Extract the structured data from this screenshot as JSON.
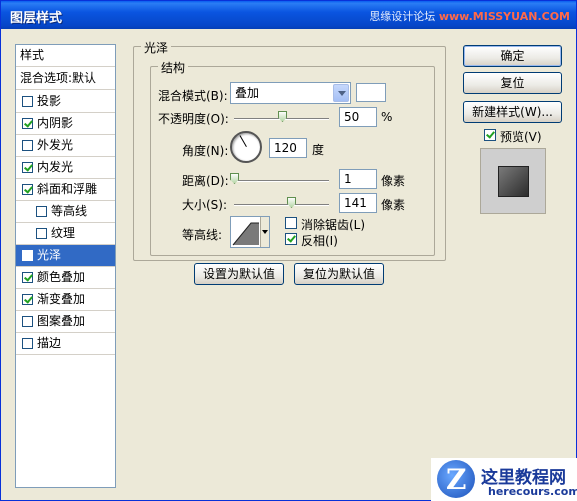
{
  "window": {
    "title": "图层样式",
    "watermark": {
      "prefix": "思缘设计论坛 ",
      "site": "www.MISSYUAN.COM"
    }
  },
  "styles_list": {
    "header": "样式",
    "blend_options": "混合选项:默认",
    "items": [
      {
        "label": "投影",
        "checked": false
      },
      {
        "label": "内阴影",
        "checked": true
      },
      {
        "label": "外发光",
        "checked": false
      },
      {
        "label": "内发光",
        "checked": true
      },
      {
        "label": "斜面和浮雕",
        "checked": true
      },
      {
        "label": "等高线",
        "checked": false
      },
      {
        "label": "纹理",
        "checked": false
      },
      {
        "label": "光泽",
        "checked": true,
        "selected": true
      },
      {
        "label": "颜色叠加",
        "checked": true
      },
      {
        "label": "渐变叠加",
        "checked": true
      },
      {
        "label": "图案叠加",
        "checked": false
      },
      {
        "label": "描边",
        "checked": false
      }
    ]
  },
  "satin": {
    "group_title": "光泽",
    "structure_title": "结构",
    "blend_mode_label": "混合模式(B):",
    "blend_mode_value": "叠加",
    "swatch_color": "#ffffff",
    "opacity_label": "不透明度(O):",
    "opacity_value": "50",
    "opacity_unit": "%",
    "angle_label": "角度(N):",
    "angle_value": "120",
    "angle_unit": "度",
    "distance_label": "距离(D):",
    "distance_value": "1",
    "distance_unit": "像素",
    "size_label": "大小(S):",
    "size_value": "141",
    "size_unit": "像素",
    "contour_label": "等高线:",
    "antialias_label": "消除锯齿(L)",
    "antialias_checked": false,
    "invert_label": "反相(I)",
    "invert_checked": true,
    "set_default_button": "设置为默认值",
    "reset_default_button": "复位为默认值"
  },
  "right_panel": {
    "ok_button": "确定",
    "reset_button": "复位",
    "new_style_button": "新建样式(W)...",
    "preview_label": "预览(V)",
    "preview_checked": true
  },
  "logo": {
    "name": "这里教程网",
    "url": "herecours.com"
  }
}
